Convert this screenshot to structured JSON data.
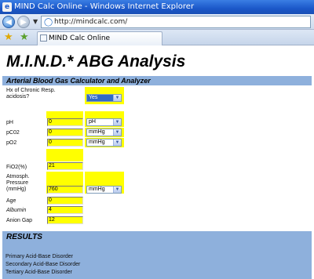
{
  "window": {
    "title": "MIND Calc Online - Windows Internet Explorer",
    "app_icon": "e"
  },
  "address_bar": {
    "url": "http://mindcalc.com/"
  },
  "tab": {
    "label": "MIND Calc Online"
  },
  "page": {
    "title": "M.I.N.D.* ABG Analysis",
    "section_title": "Arterial Blood Gas Calculator and Analyzer",
    "fields": {
      "chronic": {
        "label_line1": "Hx of Chronic Resp.",
        "label_line2": "acidosis?",
        "value": "Yes"
      },
      "ph": {
        "label": "pH",
        "value": "0",
        "unit": "pH"
      },
      "pco2": {
        "label": "pC02",
        "value": "0",
        "unit": "mmHg"
      },
      "po2": {
        "label": "pO2",
        "value": "0",
        "unit": "mmHg"
      },
      "fio2": {
        "label": "FiO2(%)",
        "value": "21"
      },
      "atm": {
        "label_line1": "Atmosph.",
        "label_line2": "Pressure",
        "label_line3": "(mmHg)",
        "value": "760",
        "unit": "mmHg"
      },
      "age": {
        "label": "Age",
        "value": "0"
      },
      "albumin": {
        "label": "Albumin",
        "value": "4"
      },
      "anion_gap": {
        "label": "Anion Gap",
        "value": "12"
      }
    },
    "results": {
      "title": "RESULTS",
      "primary": "Primary Acid-Base Disorder",
      "secondary": "Secondary Acid-Base Disorder",
      "tertiary": "Tertiary Acid-Base Disorder"
    }
  },
  "colors": {
    "input_highlight": "#ffff00",
    "section_bar": "#8eb0dc",
    "titlebar": "#1b58c9"
  },
  "icons": [
    "ie-icon",
    "back-icon",
    "forward-icon",
    "favorites-star-icon",
    "add-favorites-icon",
    "dropdown-arrow-icon",
    "page-tab-icon"
  ]
}
